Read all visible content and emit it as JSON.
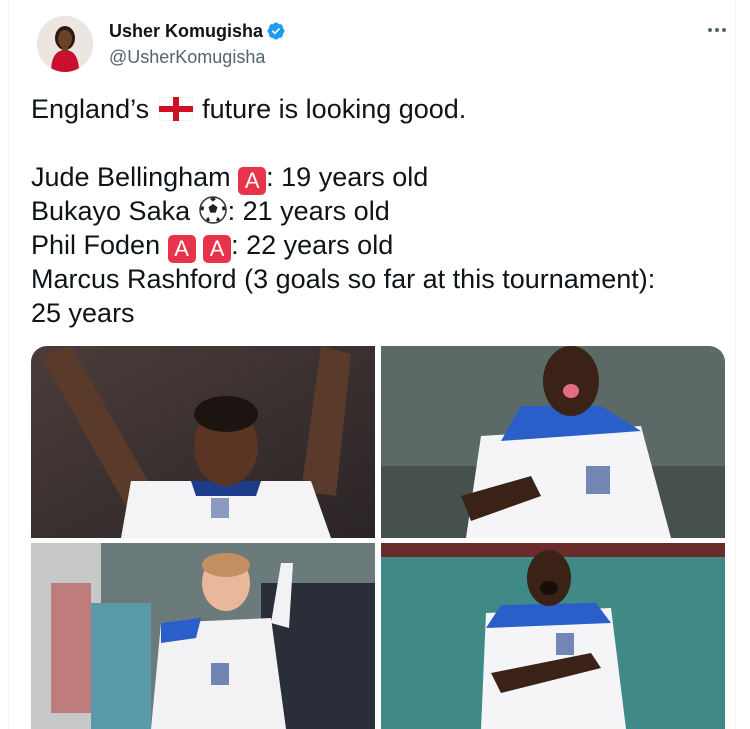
{
  "author": {
    "display_name": "Usher Komugisha",
    "handle": "@UsherKomugisha",
    "verified_icon": "verified-badge-icon",
    "avatar_icon": "avatar"
  },
  "tweet": {
    "line1_prefix": "England’s",
    "line1_suffix": "future is looking good.",
    "flag_icon": "england-flag-icon",
    "players": [
      {
        "name": "Jude Bellingham",
        "age_text": ": 19 years old",
        "badge": "A"
      },
      {
        "name": "Bukayo Saka",
        "age_text": ": 21 years old",
        "icon": "soccer-ball-icon"
      },
      {
        "name": "Phil Foden",
        "age_text": ": 22 years old",
        "badges": [
          "A",
          "A"
        ]
      },
      {
        "name": "Marcus Rashford (3 goals so far at this tournament):",
        "age_text": "25 years"
      }
    ]
  },
  "media": {
    "photos": [
      {
        "subject": "player-celebrating-arms-raised"
      },
      {
        "subject": "player-tongue-out-celebration"
      },
      {
        "subject": "player-pointing-celebration"
      },
      {
        "subject": "player-shouting-celebration"
      }
    ]
  },
  "colors": {
    "text": "#0f1419",
    "secondary": "#536471",
    "verified": "#1d9bf0",
    "badge_red": "#e8344a"
  }
}
